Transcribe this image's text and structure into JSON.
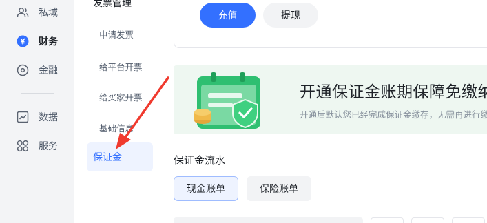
{
  "rail": {
    "items": [
      {
        "label": "私域",
        "icon": "users-icon"
      },
      {
        "label": "财务",
        "icon": "yuan-coin-icon",
        "active": true
      },
      {
        "label": "金融",
        "icon": "target-circle-icon"
      },
      {
        "label": "数据",
        "icon": "chart-line-icon"
      },
      {
        "label": "服务",
        "icon": "grid-apps-icon"
      }
    ]
  },
  "submenu": {
    "group_label": "发票管理",
    "items": [
      "申请发票",
      "给平台开票",
      "给买家开票",
      "基础信息"
    ],
    "active_item": "保证金"
  },
  "actions": {
    "recharge": "充值",
    "withdraw": "提现"
  },
  "banner": {
    "title": "开通保证金账期保障免缴纳",
    "subtitle": "开通后默认您已经完成保证金缴存，无需再进行缴纳"
  },
  "flow": {
    "title": "保证金流水",
    "tabs": [
      "现金账单",
      "保险账单"
    ]
  },
  "colors": {
    "accent": "#3370ff",
    "banner_bg": "#eef7f1",
    "illustration_green": "#2fbf71",
    "annotation_red": "#f03a2e"
  }
}
